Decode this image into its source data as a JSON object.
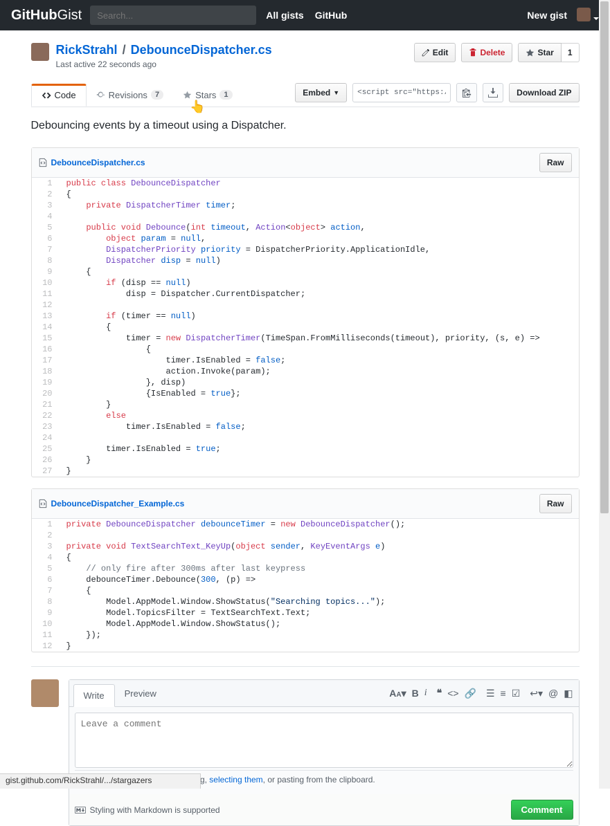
{
  "header": {
    "logo_a": "GitHub",
    "logo_b": "Gist",
    "search_placeholder": "Search...",
    "nav_allgists": "All gists",
    "nav_github": "GitHub",
    "new_gist": "New gist"
  },
  "gist": {
    "owner": "RickStrahl",
    "name": "DebounceDispatcher.cs",
    "separator": "/",
    "subline": "Last active 22 seconds ago",
    "description": "Debouncing events by a timeout using a Dispatcher."
  },
  "actions": {
    "edit": "Edit",
    "delete": "Delete",
    "star": "Star",
    "star_count": "1"
  },
  "tabs": {
    "code": "Code",
    "revisions": "Revisions",
    "revisions_count": "7",
    "stars": "Stars",
    "stars_count": "1"
  },
  "toolbar": {
    "embed": "Embed",
    "embed_value": "<script src=\"https://gist.",
    "download_zip": "Download ZIP"
  },
  "files": [
    {
      "name": "DebounceDispatcher.cs",
      "raw": "Raw",
      "lines": [
        [
          [
            "public",
            "r"
          ],
          [
            " ",
            ""
          ],
          [
            "class",
            "r"
          ],
          [
            " ",
            ""
          ],
          [
            "DebounceDispatcher",
            "p"
          ]
        ],
        [
          [
            "{",
            ""
          ]
        ],
        [
          [
            "    ",
            ""
          ],
          [
            "private",
            "r"
          ],
          [
            " ",
            ""
          ],
          [
            "DispatcherTimer",
            "p"
          ],
          [
            " ",
            ""
          ],
          [
            "timer",
            "b"
          ],
          [
            ";",
            ""
          ]
        ],
        [
          [
            "",
            ""
          ]
        ],
        [
          [
            "    ",
            ""
          ],
          [
            "public",
            "r"
          ],
          [
            " ",
            ""
          ],
          [
            "void",
            "r"
          ],
          [
            " ",
            ""
          ],
          [
            "Debounce",
            "p"
          ],
          [
            "(",
            ""
          ],
          [
            "int",
            "r"
          ],
          [
            " ",
            ""
          ],
          [
            "timeout",
            "b"
          ],
          [
            ", ",
            ""
          ],
          [
            "Action",
            "p"
          ],
          [
            "<",
            ""
          ],
          [
            "object",
            "r"
          ],
          [
            "> ",
            ""
          ],
          [
            "action",
            "b"
          ],
          [
            ",",
            ""
          ]
        ],
        [
          [
            "        ",
            ""
          ],
          [
            "object",
            "r"
          ],
          [
            " ",
            ""
          ],
          [
            "param",
            "b"
          ],
          [
            " = ",
            ""
          ],
          [
            "null",
            "b"
          ],
          [
            ",",
            ""
          ]
        ],
        [
          [
            "        ",
            ""
          ],
          [
            "DispatcherPriority",
            "p"
          ],
          [
            " ",
            ""
          ],
          [
            "priority",
            "b"
          ],
          [
            " = DispatcherPriority.ApplicationIdle,",
            ""
          ]
        ],
        [
          [
            "        ",
            ""
          ],
          [
            "Dispatcher",
            "p"
          ],
          [
            " ",
            ""
          ],
          [
            "disp",
            "b"
          ],
          [
            " = ",
            ""
          ],
          [
            "null",
            "b"
          ],
          [
            ")",
            ""
          ]
        ],
        [
          [
            "    {",
            ""
          ]
        ],
        [
          [
            "        ",
            ""
          ],
          [
            "if",
            "r"
          ],
          [
            " (disp == ",
            ""
          ],
          [
            "null",
            "b"
          ],
          [
            ")",
            ""
          ]
        ],
        [
          [
            "            disp = Dispatcher.CurrentDispatcher;",
            ""
          ]
        ],
        [
          [
            "",
            ""
          ]
        ],
        [
          [
            "        ",
            ""
          ],
          [
            "if",
            "r"
          ],
          [
            " (timer == ",
            ""
          ],
          [
            "null",
            "b"
          ],
          [
            ")",
            ""
          ]
        ],
        [
          [
            "        {",
            ""
          ]
        ],
        [
          [
            "            timer = ",
            ""
          ],
          [
            "new",
            "r"
          ],
          [
            " ",
            ""
          ],
          [
            "DispatcherTimer",
            "p"
          ],
          [
            "(TimeSpan.FromMilliseconds(timeout), priority, (s, e) =>",
            ""
          ]
        ],
        [
          [
            "                {",
            ""
          ]
        ],
        [
          [
            "                    timer.IsEnabled = ",
            ""
          ],
          [
            "false",
            "b"
          ],
          [
            ";",
            ""
          ]
        ],
        [
          [
            "                    action.Invoke(param);",
            ""
          ]
        ],
        [
          [
            "                }, disp)",
            ""
          ]
        ],
        [
          [
            "                {IsEnabled = ",
            ""
          ],
          [
            "true",
            "b"
          ],
          [
            "};",
            ""
          ]
        ],
        [
          [
            "        }",
            ""
          ]
        ],
        [
          [
            "        ",
            ""
          ],
          [
            "else",
            "r"
          ]
        ],
        [
          [
            "            timer.IsEnabled = ",
            ""
          ],
          [
            "false",
            "b"
          ],
          [
            ";",
            ""
          ]
        ],
        [
          [
            "",
            ""
          ]
        ],
        [
          [
            "        timer.IsEnabled = ",
            ""
          ],
          [
            "true",
            "b"
          ],
          [
            ";",
            ""
          ]
        ],
        [
          [
            "    }",
            ""
          ]
        ],
        [
          [
            "}",
            ""
          ]
        ]
      ]
    },
    {
      "name": "DebounceDispatcher_Example.cs",
      "raw": "Raw",
      "lines": [
        [
          [
            "private",
            "r"
          ],
          [
            " ",
            ""
          ],
          [
            "DebounceDispatcher",
            "p"
          ],
          [
            " ",
            ""
          ],
          [
            "debounceTimer",
            "b"
          ],
          [
            " = ",
            ""
          ],
          [
            "new",
            "r"
          ],
          [
            " ",
            ""
          ],
          [
            "DebounceDispatcher",
            "p"
          ],
          [
            "();",
            ""
          ]
        ],
        [
          [
            "",
            ""
          ]
        ],
        [
          [
            "private",
            "r"
          ],
          [
            " ",
            ""
          ],
          [
            "void",
            "r"
          ],
          [
            " ",
            ""
          ],
          [
            "TextSearchText_KeyUp",
            "p"
          ],
          [
            "(",
            ""
          ],
          [
            "object",
            "r"
          ],
          [
            " ",
            ""
          ],
          [
            "sender",
            "b"
          ],
          [
            ", ",
            ""
          ],
          [
            "KeyEventArgs",
            "p"
          ],
          [
            " ",
            ""
          ],
          [
            "e",
            "b"
          ],
          [
            ")",
            ""
          ]
        ],
        [
          [
            "{",
            ""
          ]
        ],
        [
          [
            "    ",
            ""
          ],
          [
            "// only fire after 300ms after last keypress",
            "g"
          ]
        ],
        [
          [
            "    debounceTimer.Debounce(",
            ""
          ],
          [
            "300",
            "b"
          ],
          [
            ", (p) =>",
            ""
          ]
        ],
        [
          [
            "    {",
            ""
          ]
        ],
        [
          [
            "        Model.AppModel.Window.ShowStatus(",
            ""
          ],
          [
            "\"Searching topics...\"",
            "s"
          ],
          [
            ");",
            ""
          ]
        ],
        [
          [
            "        Model.TopicsFilter = TextSearchText.Text;",
            ""
          ]
        ],
        [
          [
            "        Model.AppModel.Window.ShowStatus();",
            ""
          ]
        ],
        [
          [
            "    });",
            ""
          ]
        ],
        [
          [
            "}",
            ""
          ]
        ]
      ]
    }
  ],
  "comment": {
    "tab_write": "Write",
    "tab_preview": "Preview",
    "placeholder": "Leave a comment",
    "attach_hint_a": "Attach files by dragging & dropping, ",
    "attach_hint_link": "selecting them",
    "attach_hint_b": ", or pasting from the clipboard.",
    "md_hint": "Styling with Markdown is supported",
    "submit": "Comment"
  },
  "statusbar": "gist.github.com/RickStrahl/.../stargazers"
}
